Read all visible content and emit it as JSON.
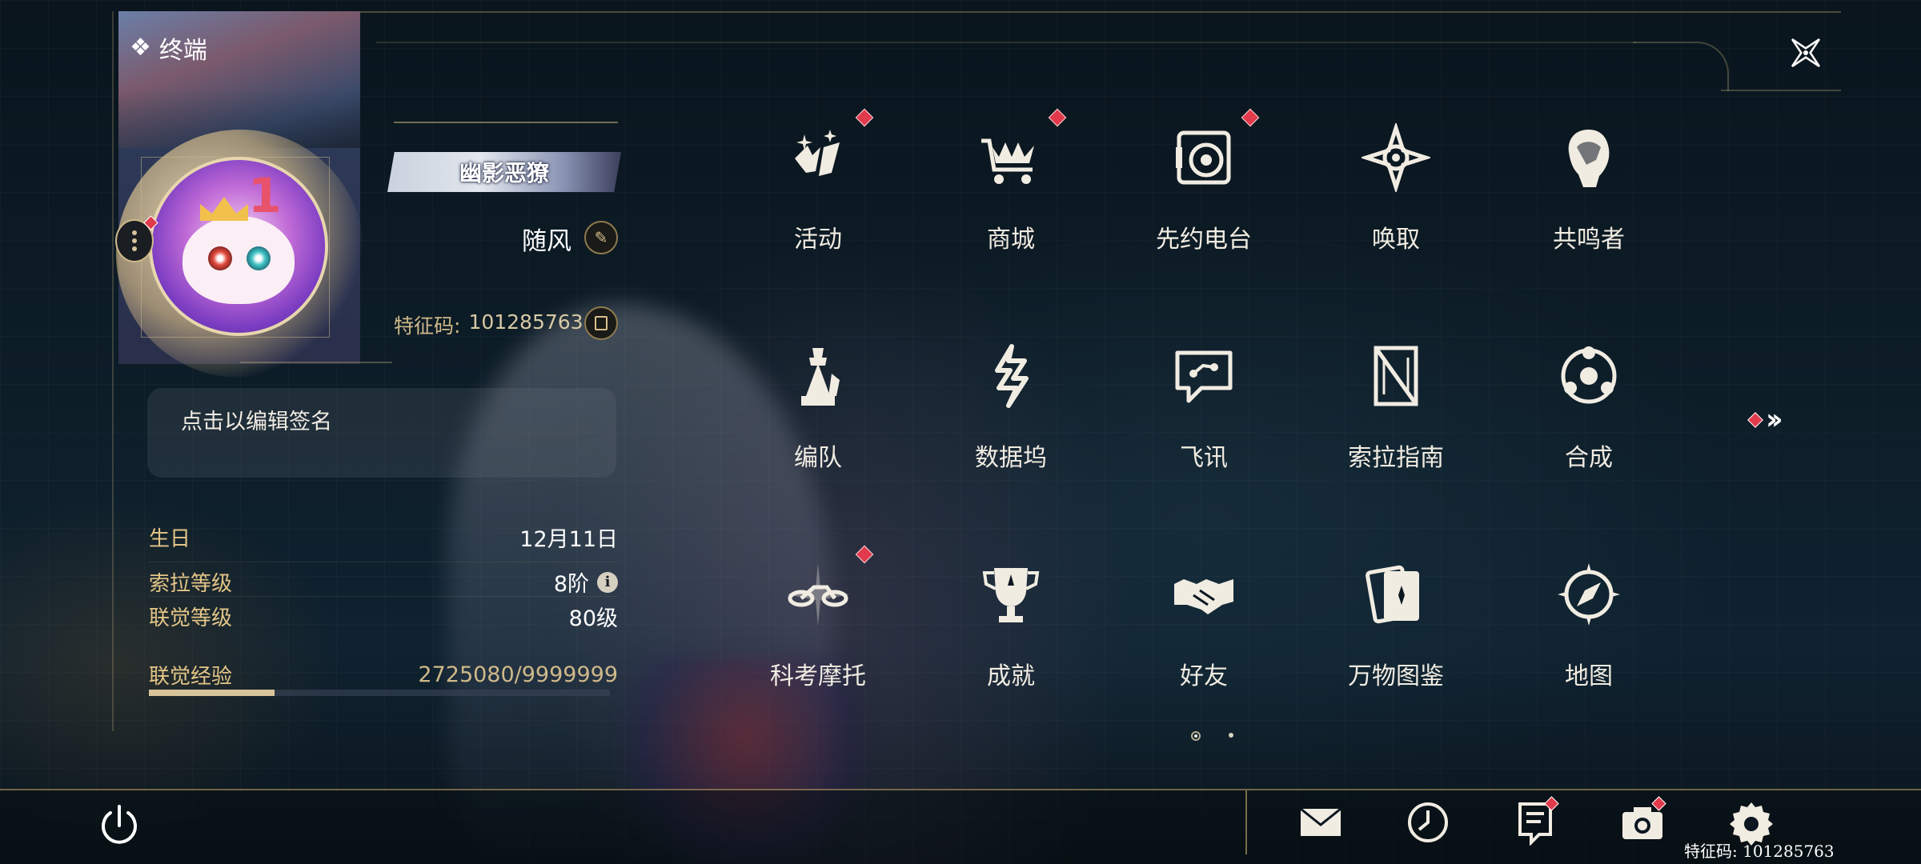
{
  "header": {
    "terminal_title": "终端"
  },
  "profile": {
    "title_badge": "幽影恶獠",
    "player_name": "随风",
    "uid_label": "特征码:",
    "uid_value": "101285763",
    "signature_placeholder": "点击以编辑签名",
    "stats": [
      {
        "label": "生日",
        "value": "12月11日"
      },
      {
        "label": "索拉等级",
        "value": "8阶"
      },
      {
        "label": "联觉等级",
        "value": "80级"
      }
    ],
    "exp": {
      "label": "联觉经验",
      "value": "2725080/9999999",
      "progress": 0.2725
    }
  },
  "menu": {
    "items": [
      {
        "label": "活动",
        "icon": "activity-icon",
        "badge": true
      },
      {
        "label": "商城",
        "icon": "shop-icon",
        "badge": true
      },
      {
        "label": "先约电台",
        "icon": "radio-icon",
        "badge": true
      },
      {
        "label": "唤取",
        "icon": "convene-icon",
        "badge": false
      },
      {
        "label": "共鸣者",
        "icon": "resonator-icon",
        "badge": false
      },
      {
        "label": "编队",
        "icon": "team-icon",
        "badge": false
      },
      {
        "label": "数据坞",
        "icon": "data-bank-icon",
        "badge": false
      },
      {
        "label": "飞讯",
        "icon": "chat-icon",
        "badge": false
      },
      {
        "label": "索拉指南",
        "icon": "guidebook-icon",
        "badge": false
      },
      {
        "label": "合成",
        "icon": "synthesis-icon",
        "badge": false
      },
      {
        "label": "科考摩托",
        "icon": "motorcycle-icon",
        "badge": true
      },
      {
        "label": "成就",
        "icon": "trophy-icon",
        "badge": false
      },
      {
        "label": "好友",
        "icon": "handshake-icon",
        "badge": false
      },
      {
        "label": "万物图鉴",
        "icon": "archive-card-icon",
        "badge": false
      },
      {
        "label": "地图",
        "icon": "compass-icon",
        "badge": false
      }
    ],
    "page_current": 1,
    "page_total": 2
  },
  "bottom_bar": {
    "uid_text": "特征码: 101285763",
    "tools": [
      {
        "icon": "mail-icon",
        "badge": false
      },
      {
        "icon": "clock-icon",
        "badge": false
      },
      {
        "icon": "notice-icon",
        "badge": true
      },
      {
        "icon": "camera-icon",
        "badge": true
      },
      {
        "icon": "settings-gear-icon",
        "badge": false
      }
    ]
  },
  "colors": {
    "accent_gold": "#d8c49a",
    "badge_red": "#e03a4c",
    "text_light": "#f1ece2"
  }
}
